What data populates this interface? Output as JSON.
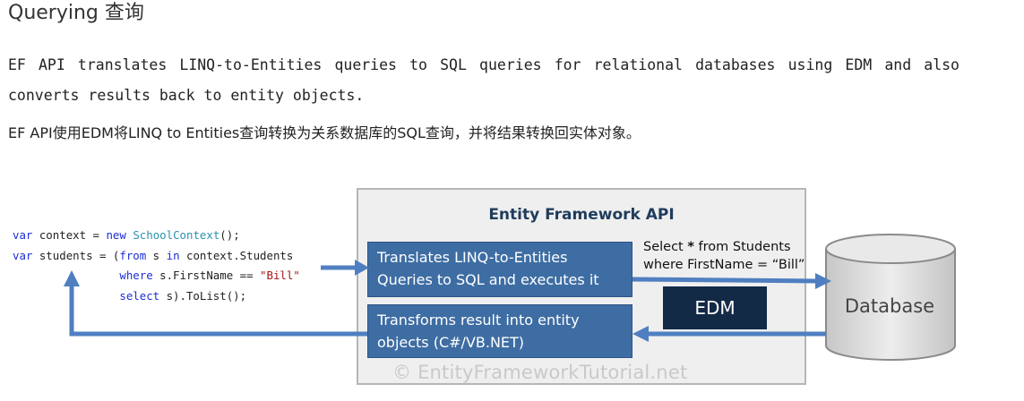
{
  "heading": "Querying 查询",
  "paragraph_en_line1": "EF API translates LINQ-to-Entities queries to SQL queries for relational databases using EDM and also",
  "paragraph_en_line2": "converts results back to entity objects.",
  "paragraph_cn": "EF API使用EDM将LINQ to Entities查询转换为关系数据库的SQL查询，并将结果转换回实体对象。",
  "diagram": {
    "code": {
      "line1": {
        "kw1": "var",
        "t1": " context = ",
        "kw2": "new",
        "t2": " ",
        "type": "SchoolContext",
        "t3": "();"
      },
      "line2": {
        "kw1": "var",
        "t1": " students = (",
        "kw2": "from",
        "t2": " s ",
        "kw3": "in",
        "t3": " context.Students"
      },
      "line3": {
        "indent": "                ",
        "kw1": "where",
        "t1": " s.FirstName == ",
        "str": "\"Bill\""
      },
      "line4": {
        "indent": "                ",
        "kw1": "select",
        "t1": " s).ToList();"
      }
    },
    "api_title": "Entity Framework API",
    "translate_box_line1": "Translates LINQ-to-Entities",
    "translate_box_line2": "Queries to SQL and executes it",
    "transform_box_line1": "Transforms result into entity",
    "transform_box_line2": "objects (C#/VB.NET)",
    "sql_line1_a": "Select ",
    "sql_line1_star": "*",
    "sql_line1_b": " from Students",
    "sql_line2": "where FirstName = “Bill”",
    "edm_label": "EDM",
    "database_label": "Database",
    "watermark": "© EntityFrameworkTutorial.net",
    "colors": {
      "box_blue": "#3e6da3",
      "edm_navy": "#132a47",
      "arrow_blue": "#4f7fc0",
      "api_title": "#1f3c5c"
    }
  }
}
